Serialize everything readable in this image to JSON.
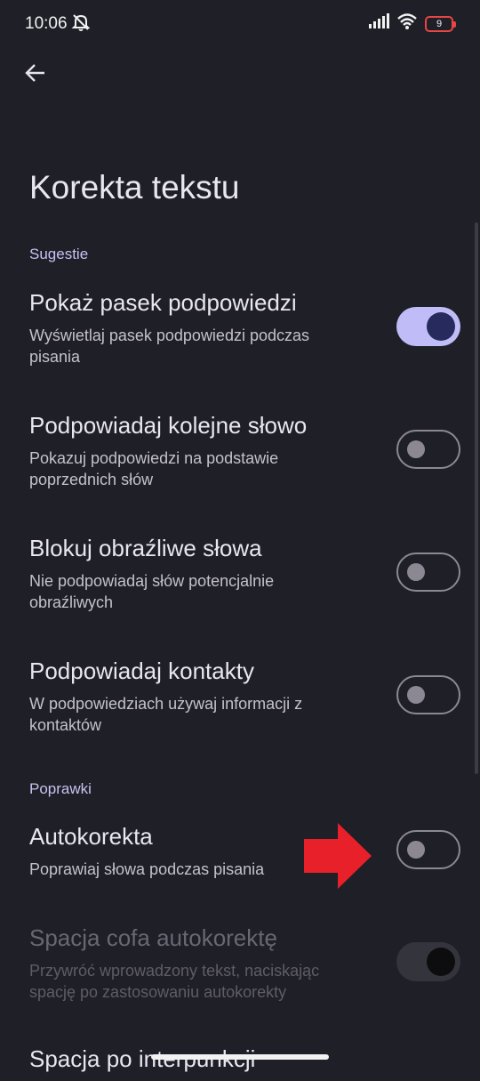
{
  "status_bar": {
    "time": "10:06",
    "battery_level": "9",
    "icons": [
      "mute-bell-icon",
      "signal-icon",
      "wifi-icon",
      "battery-icon"
    ],
    "battery_color": "#e84545"
  },
  "header": {
    "back_icon": "arrow-left-icon",
    "title": "Korekta tekstu"
  },
  "sections": {
    "suggestions": {
      "header": "Sugestie",
      "items": [
        {
          "title": "Pokaż pasek podpowiedzi",
          "description": "Wyświetlaj pasek podpowiedzi podczas pisania",
          "state": "on"
        },
        {
          "title": "Podpowiadaj kolejne słowo",
          "description": "Pokazuj podpowiedzi na podstawie poprzednich słów",
          "state": "off"
        },
        {
          "title": "Blokuj obraźliwe słowa",
          "description": "Nie podpowiadaj słów potencjalnie obraźliwych",
          "state": "off"
        },
        {
          "title": "Podpowiadaj kontakty",
          "description": "W podpowiedziach używaj informacji z kontaktów",
          "state": "off"
        }
      ]
    },
    "corrections": {
      "header": "Poprawki",
      "items": [
        {
          "title": "Autokorekta",
          "description": "Poprawiaj słowa podczas pisania",
          "state": "off"
        },
        {
          "title": "Spacja cofa autokorektę",
          "description": "Przywróć wprowadzony tekst, naciskając spację po zastosowaniu autokorekty",
          "state": "on",
          "disabled": true
        },
        {
          "title": "Spacja po interpunkcji"
        }
      ]
    }
  },
  "colors": {
    "background": "#1f1f27",
    "accent": "#bfbcf7",
    "section_header": "#c7c2f2",
    "annotation_arrow": "#e8202a"
  }
}
